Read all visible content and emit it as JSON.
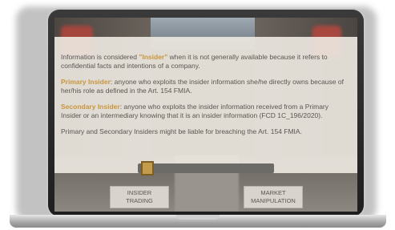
{
  "content": {
    "paragraph1_prefix": "Information is considered ",
    "paragraph1_term": "\"Insider\"",
    "paragraph1_suffix": " when it is not generally available because it refers to confidential facts and intentions of a company.",
    "primary_term": "Primary Insider",
    "primary_text": ": anyone who exploits the insider information she/he directly owns because of her/his role as defined in the Art. 154 FMIA.",
    "secondary_term": "Secondary Insider",
    "secondary_text": ": anyone who exploits the insider information received from a Primary Insider or an intermediary knowing that it is an insider information (FCD 1C_196/2020).",
    "footer_text": "Primary and Secondary Insiders might be liable for breaching the Art. 154 FMIA."
  },
  "navigation": {
    "left_button": "INSIDER TRADING",
    "right_button": "MARKET MANIPULATION"
  },
  "progress": {
    "value": 0.05
  },
  "colors": {
    "term": "#c9953e",
    "overlay": "#ece7e0",
    "track": "#6d6b68",
    "handle": "#c29c4a"
  }
}
